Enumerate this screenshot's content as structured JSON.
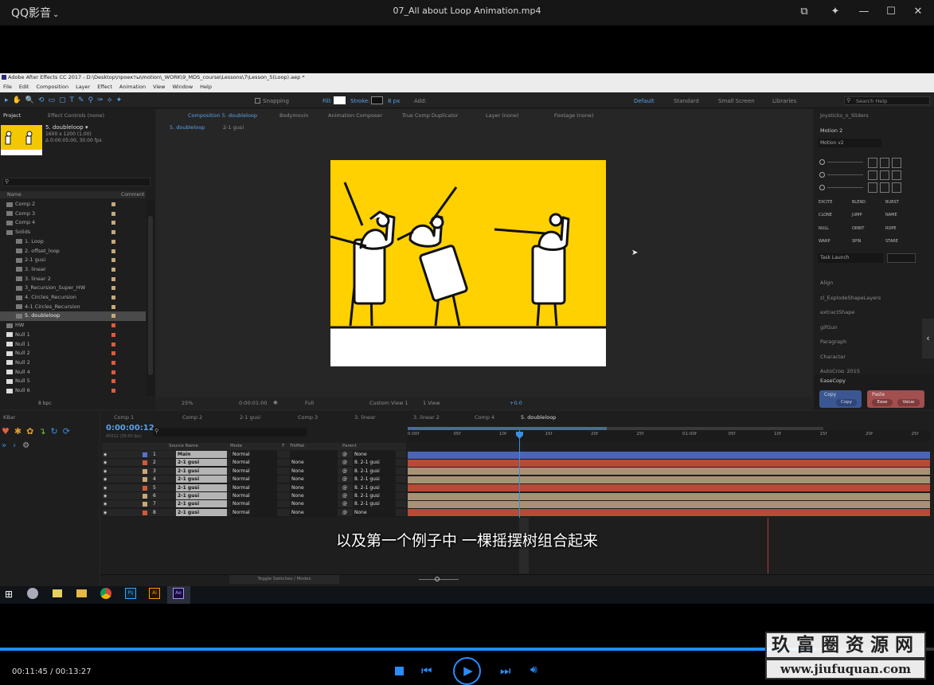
{
  "player": {
    "app": "QQ影音",
    "chevron": "⌄",
    "title": "07_All about Loop Animation.mp4",
    "time": "00:11:45 / 00:13:27",
    "progress": 0.874
  },
  "ae": {
    "title": "Adobe After Effects CC 2017 - D:\\Desktop\\проекты\\motion\\_WORK\\9_MDS_course\\Lessons\\7\\Lesson_5(Loop).aep *",
    "menu": [
      "File",
      "Edit",
      "Composition",
      "Layer",
      "Effect",
      "Animation",
      "View",
      "Window",
      "Help"
    ],
    "toolbar": {
      "snapping": "Snapping",
      "fill": "Fill:",
      "stroke": "Stroke:",
      "px": "8 px",
      "add": "Add:",
      "workspaces": [
        "Default",
        "Standard",
        "Small Screen",
        "Libraries"
      ],
      "search": "Search Help"
    },
    "project": {
      "tab": "Project",
      "effect_tab": "Effect Controls (none)",
      "comp_name": "5. doubleloop ▾",
      "comp_info1": "1600 x 1200 (1.00)",
      "comp_info2": "Δ 0:00:05:00, 30.00 fps",
      "col_name": "Name",
      "col_comment": "Comment",
      "items": [
        {
          "name": "Comp 2",
          "sw": "#c8a878"
        },
        {
          "name": "Comp 3",
          "sw": "#c8a878"
        },
        {
          "name": "Comp 4",
          "sw": "#c8a878"
        },
        {
          "name": "Solids",
          "sw": "#c8a878"
        },
        {
          "name": "1. Loop",
          "sw": "#c8a878"
        },
        {
          "name": "2. offset_loop",
          "sw": "#c8a878"
        },
        {
          "name": "2-1 gusi",
          "sw": "#c8a878"
        },
        {
          "name": "3. linear",
          "sw": "#c8a878"
        },
        {
          "name": "3. linear 2",
          "sw": "#c8a878"
        },
        {
          "name": "3_Recursion_Super_HW",
          "sw": "#c8a878"
        },
        {
          "name": "4. Circles_Recursion",
          "sw": "#c8a878"
        },
        {
          "name": "4-1 Circles_Recursion",
          "sw": "#c8a878"
        },
        {
          "name": "5. doubleloop",
          "sw": "#c8a878"
        },
        {
          "name": "HW",
          "sw": "#e05a3a"
        },
        {
          "name": "Null 1",
          "sw": "#e05a3a"
        },
        {
          "name": "Null 1",
          "sw": "#e05a3a"
        },
        {
          "name": "Null 2",
          "sw": "#e05a3a"
        },
        {
          "name": "Null 2",
          "sw": "#e05a3a"
        },
        {
          "name": "Null 4",
          "sw": "#e05a3a"
        },
        {
          "name": "Null 5",
          "sw": "#e05a3a"
        },
        {
          "name": "Null 6",
          "sw": "#e05a3a"
        }
      ],
      "bpc": "8 bpc"
    },
    "viewer": {
      "tabs": [
        "Composition 5. doubleloop",
        "Bodymovin",
        "Animation Composer",
        "True Comp Duplicator",
        "Layer (none)",
        "Footage (none)"
      ],
      "sub_tabs": [
        "5. doubleloop",
        "2-1 gusi"
      ],
      "zoom": "25%",
      "time": "0:00:01:00",
      "res": "Full",
      "view": "Custom View 1",
      "views": "1 View",
      "exposure": "+0.0"
    },
    "right": {
      "top_item": "Joysticks_n_Sliders",
      "motion": "Motion 2",
      "motion_v": "Motion v2",
      "buttons": [
        "EXCITE",
        "BLEND",
        "BURST",
        "CLONE",
        "JUMP",
        "NAME",
        "NULL",
        "ORBIT",
        "ROPE",
        "WARP",
        "SPIN",
        "STARE"
      ],
      "task": "Task Launch",
      "panels": [
        "Align",
        "zl_ExplodeShapeLayers",
        "extractShape",
        "gifGun",
        "Paragraph",
        "Character",
        "AutoCrop_2015"
      ],
      "easecopy": "EaseCopy",
      "copy": "Copy",
      "paste": "Paste",
      "copy_btn": "Copy",
      "ease_btn": "Ease",
      "value_btn": "Value"
    },
    "kbar": "KBar",
    "timeline": {
      "tabs": [
        "Comp 1",
        "Comp 2",
        "2-1 gusi",
        "Comp 3",
        "3. linear",
        "3. linear 2",
        "Comp 4",
        "5. doubleloop"
      ],
      "timecode": "0:00:00:12",
      "fps": "00012 (30.00 fps)",
      "cols": {
        "source": "Source Name",
        "mode": "Mode",
        "t": "T",
        "trkmat": "TrkMat",
        "parent": "Parent"
      },
      "layers": [
        {
          "n": "1",
          "name": "Main",
          "mode": "Normal",
          "trk": "",
          "parent": "None",
          "color": "#5a6fd0",
          "bar": "#4a64b8"
        },
        {
          "n": "2",
          "name": "2-1 gusi",
          "mode": "Normal",
          "trk": "None",
          "parent": "8. 2-1 gusi",
          "color": "#d05a3a",
          "bar": "#b84a36"
        },
        {
          "n": "3",
          "name": "2-1 gusi",
          "mode": "Normal",
          "trk": "None",
          "parent": "8. 2-1 gusi",
          "color": "#c8a878",
          "bar": "#a89276"
        },
        {
          "n": "4",
          "name": "2-1 gusi",
          "mode": "Normal",
          "trk": "None",
          "parent": "8. 2-1 gusi",
          "color": "#c8a878",
          "bar": "#a89276"
        },
        {
          "n": "5",
          "name": "2-1 gusi",
          "mode": "Normal",
          "trk": "None",
          "parent": "8. 2-1 gusi",
          "color": "#d05a3a",
          "bar": "#b84a36"
        },
        {
          "n": "6",
          "name": "2-1 gusi",
          "mode": "Normal",
          "trk": "None",
          "parent": "8. 2-1 gusi",
          "color": "#c8a878",
          "bar": "#a89276"
        },
        {
          "n": "7",
          "name": "2-1 gusi",
          "mode": "Normal",
          "trk": "None",
          "parent": "8. 2-1 gusi",
          "color": "#c8a878",
          "bar": "#a89276"
        },
        {
          "n": "8",
          "name": "2-1 gusi",
          "mode": "Normal",
          "trk": "None",
          "parent": "None",
          "color": "#d05a3a",
          "bar": "#b84a36"
        }
      ],
      "ruler": [
        "0:00f",
        "05f",
        "10f",
        "15f",
        "20f",
        "25f",
        "01:00f",
        "05f",
        "10f",
        "15f",
        "20f",
        "25f"
      ],
      "toggle": "Toggle Switches / Modes"
    }
  },
  "subtitle": "以及第一个例子中 一棵摇摆树组合起来",
  "taskbar": {
    "apps": [
      "Ps",
      "Ai",
      "Ae"
    ]
  },
  "watermark": {
    "title": "玖富圈资源网",
    "url": "www.jiufuquan.com"
  }
}
